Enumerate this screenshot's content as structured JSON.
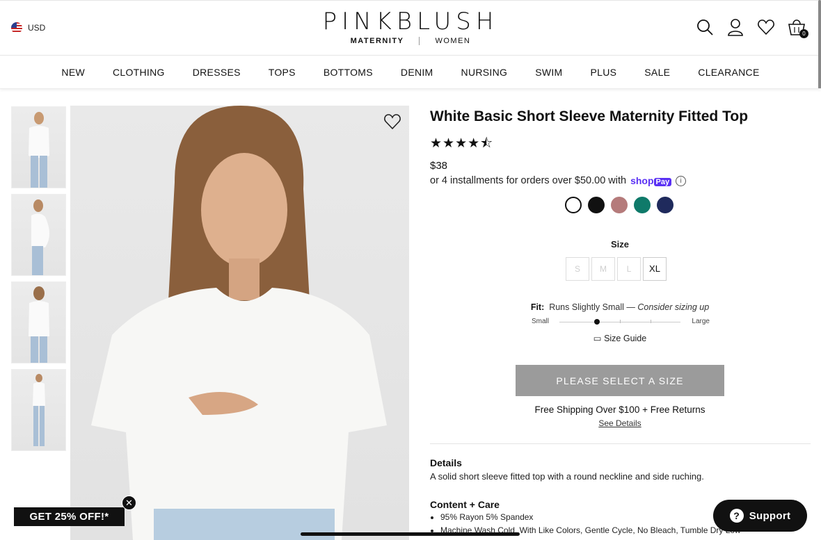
{
  "header": {
    "currency": "USD",
    "brand": "PINKBLUSH",
    "brand_sub": {
      "left": "MATERNITY",
      "right": "WOMEN"
    },
    "cart_count": "0",
    "icons": [
      "search-icon",
      "account-icon",
      "heart-icon",
      "cart-icon"
    ]
  },
  "nav": [
    "NEW",
    "CLOTHING",
    "DRESSES",
    "TOPS",
    "BOTTOMS",
    "DENIM",
    "NURSING",
    "SWIM",
    "PLUS",
    "SALE",
    "CLEARANCE"
  ],
  "product": {
    "title": "White Basic Short Sleeve Maternity Fitted Top",
    "rating_stars": "★★★★⯪",
    "rating_value": 4.5,
    "price": "$38",
    "installments": "or 4 installments for orders over $50.00 with",
    "shoppay": {
      "shop": "shop",
      "pay": "Pay"
    },
    "colors": [
      "#ffffff",
      "#111111",
      "#b57b7b",
      "#0f7a6a",
      "#1f2a5c"
    ],
    "size_label": "Size",
    "sizes": [
      {
        "label": "S",
        "available": false
      },
      {
        "label": "M",
        "available": false
      },
      {
        "label": "L",
        "available": false
      },
      {
        "label": "XL",
        "available": true
      }
    ],
    "fit": {
      "label": "Fit:",
      "text": "Runs Slightly Small —",
      "advice": "Consider sizing up",
      "small": "Small",
      "large": "Large",
      "position": 0.31
    },
    "size_guide": "Size Guide",
    "cta": "PLEASE SELECT A SIZE",
    "shipping": "Free Shipping Over $100 + Free Returns",
    "see_details": "See Details",
    "details_title": "Details",
    "details_text": "A solid short sleeve fitted top with a round neckline and side ruching.",
    "care_title": "Content + Care",
    "care": [
      "95% Rayon 5% Spandex",
      "Machine Wash Cold, With Like Colors, Gentle Cycle, No Bleach, Tumble Dry Low"
    ]
  },
  "overlays": {
    "promo": "GET 25% OFF!*",
    "support": "Support"
  }
}
